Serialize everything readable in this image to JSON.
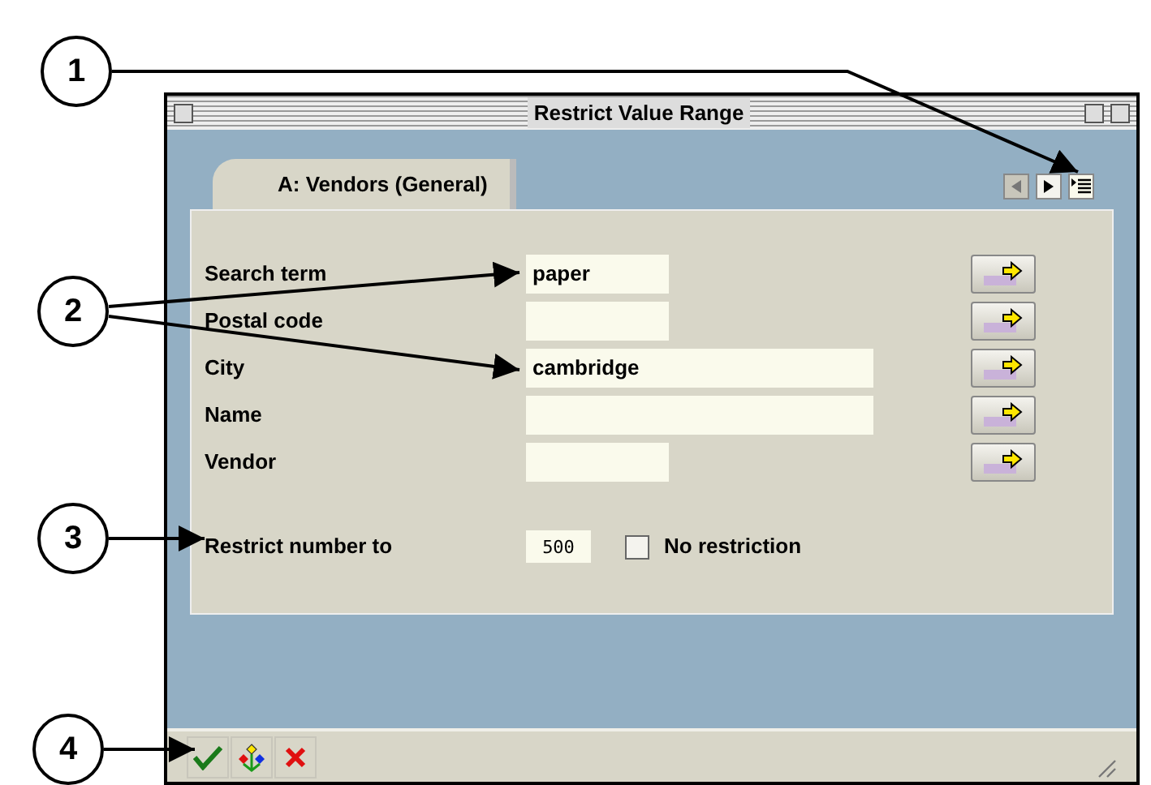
{
  "window": {
    "title": "Restrict Value Range"
  },
  "tabs": [
    {
      "label": "A: Vendors (General)",
      "selected": true
    }
  ],
  "fields": [
    {
      "label": "Search term",
      "value": "paper",
      "kind": "short"
    },
    {
      "label": "Postal code",
      "kind": "short"
    },
    {
      "label": "City",
      "value": "cambridge",
      "kind": "long"
    },
    {
      "label": "Name",
      "kind": "long"
    },
    {
      "label": "Vendor",
      "kind": "short"
    }
  ],
  "restrict": {
    "label": "Restrict number to",
    "value": "500",
    "checkbox_label": "No restriction",
    "checked": false
  },
  "callouts": [
    "1",
    "2",
    "3",
    "4"
  ]
}
